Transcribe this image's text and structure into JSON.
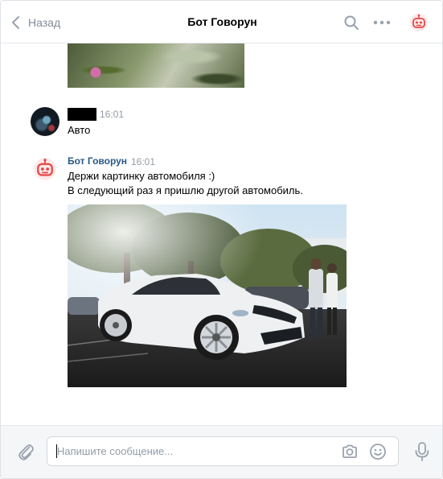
{
  "header": {
    "back_label": "Назад",
    "title": "Бот Говорун",
    "icons": [
      "chevron-left-icon",
      "search-icon",
      "more-icon",
      "bot-avatar-icon"
    ]
  },
  "messages": {
    "user_message": {
      "time": "16:01",
      "text": "Авто"
    },
    "bot_message": {
      "author": "Бот Говорун",
      "time": "16:01",
      "line1": "Держи картинку автомобиля :)",
      "line2": "В следующий раз я пришлю другой автомобиль."
    }
  },
  "composer": {
    "placeholder": "Напишите сообщение...",
    "icons": [
      "attach-icon",
      "camera-icon",
      "emoji-icon",
      "microphone-icon"
    ]
  },
  "colors": {
    "accent": "#2a5885",
    "muted": "#818c99",
    "bot_red": "#e64646"
  }
}
